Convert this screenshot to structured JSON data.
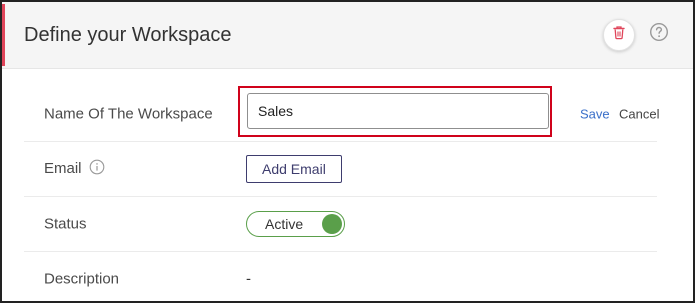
{
  "header": {
    "title": "Define your Workspace",
    "icons": {
      "delete": "trash-icon",
      "help": "help-circle-icon"
    },
    "accent_color": "#e0455a"
  },
  "form": {
    "name_label": "Name Of The Workspace",
    "name_value": "Sales",
    "save_label": "Save",
    "cancel_label": "Cancel",
    "email_label": "Email",
    "email_info_icon": "info-icon",
    "add_email_label": "Add Email",
    "status_label": "Status",
    "status_value": "Active",
    "description_label": "Description",
    "description_value": "-"
  },
  "colors": {
    "highlight": "#d0021b",
    "link": "#3a6fc9",
    "active": "#5a9f4a",
    "button_border": "#3e3d6e"
  }
}
